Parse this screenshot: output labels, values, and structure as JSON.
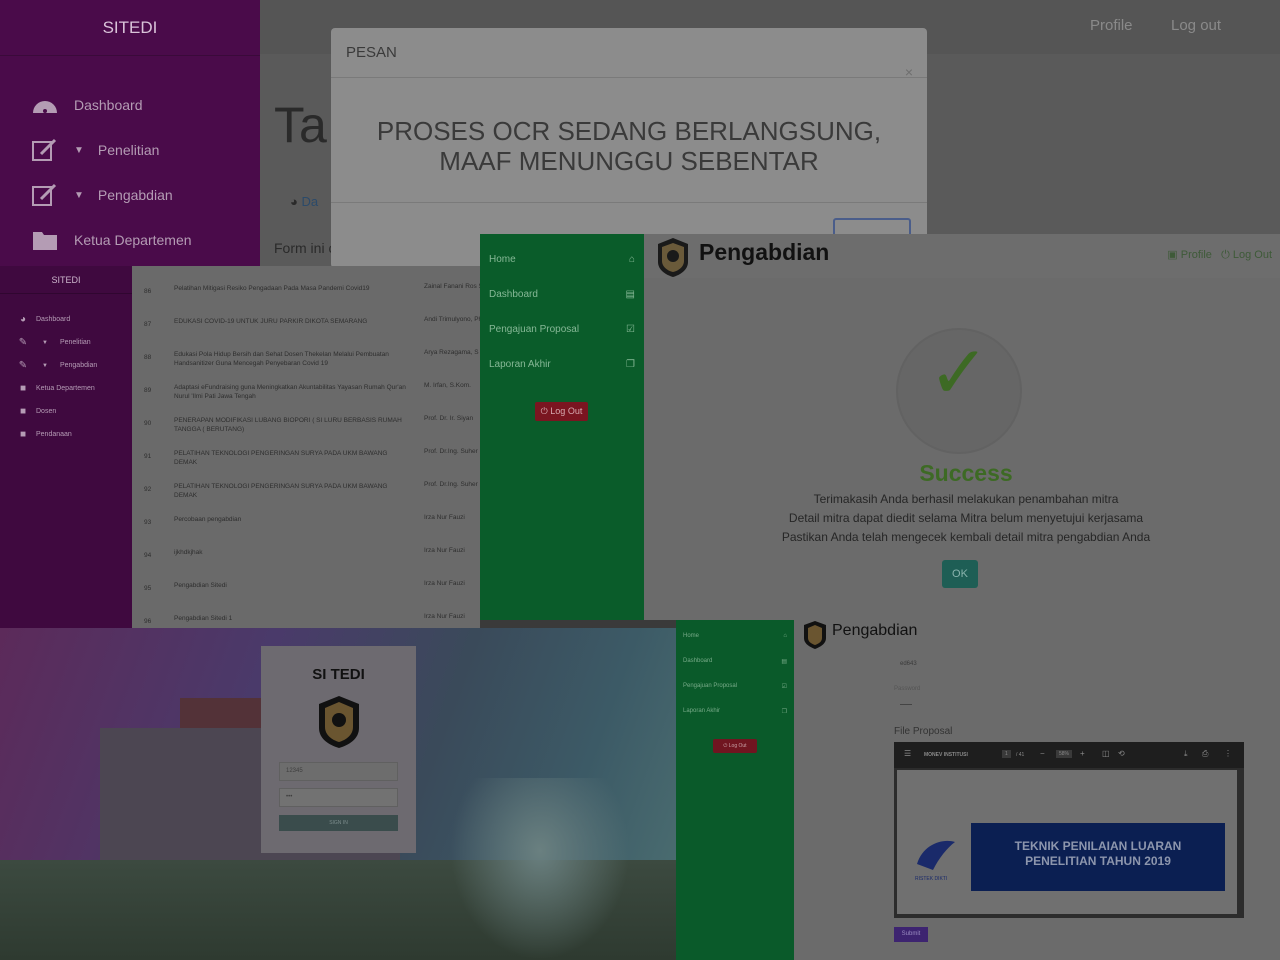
{
  "panel1": {
    "brand": "SITEDI",
    "nav": [
      "Dashboard",
      "Penelitian",
      "Pengabdian",
      "Ketua Departemen"
    ],
    "top_links": [
      "Profile",
      "Log out"
    ],
    "page_title": "Ta",
    "breadcrumb": "Da",
    "form_text": "Form ini c",
    "modal": {
      "title": "PESAN",
      "close": "×",
      "line1": "PROSES OCR SEDANG BERLANGSUNG,",
      "line2": "MAAF MENUNGGU SEBENTAR"
    }
  },
  "panel2": {
    "brand": "SITEDI",
    "nav": [
      "Dashboard",
      "Penelitian",
      "Pengabdian",
      "Ketua Departemen",
      "Dosen",
      "Pendanaan"
    ],
    "rows": [
      {
        "num": "86",
        "title": "Pelatihan Mitigasi Resiko Pengadaan Pada Masa Pandemi Covid19",
        "who": "Zainal Fanani Ros S.T., M.T."
      },
      {
        "num": "87",
        "title": "EDUKASI COVID-19 UNTUK JURU PARKIR DIKOTA SEMARANG",
        "who": "Andi Trimulyono, Ph.D."
      },
      {
        "num": "88",
        "title": "Edukasi Pola Hidup Bersih dan Sehat Dosen Thekelan Melalui Pembuatan Handsanitizer Guna Mencegah Penyebaran Covid 19",
        "who": "Arya Rezagama, S"
      },
      {
        "num": "89",
        "title": "Adaptasi eFundraising guna Meningkatkan Akuntabilitas Yayasan Rumah Qur'an Nurul 'Ilmi Pati Jawa Tengah",
        "who": "M. Irfan, S.Kom."
      },
      {
        "num": "90",
        "title": "PENERAPAN MODIFIKASI LUBANG BIOPORI ( SI LURU BERBASIS RUMAH TANGGA ( BERUTANG)",
        "who": "Prof. Dr. Ir. Siyan"
      },
      {
        "num": "91",
        "title": "PELATIHAN TEKNOLOGI PENGERINGAN SURYA PADA UKM BAWANG DEMAK",
        "who": "Prof. Dr.Ing. Suher S.T., M.T."
      },
      {
        "num": "92",
        "title": "PELATIHAN TEKNOLOGI PENGERINGAN SURYA PADA UKM BAWANG DEMAK",
        "who": "Prof. Dr.Ing. Suher S.T., M.T."
      },
      {
        "num": "93",
        "title": "Percobaan pengabdian",
        "who": "Irza Nur Fauzi"
      },
      {
        "num": "94",
        "title": "ijkhdkjhak",
        "who": "Irza Nur Fauzi"
      },
      {
        "num": "95",
        "title": "Pengabdian Sitedi",
        "who": "Irza Nur Fauzi"
      },
      {
        "num": "96",
        "title": "Pengabdian Sitedi 1",
        "who": "Irza Nur Fauzi"
      }
    ]
  },
  "panel3": {
    "nav": [
      "Home",
      "Dashboard",
      "Pengajuan Proposal",
      "Laporan Akhir"
    ],
    "logout_button": "Log Out",
    "title": "Pengabdian",
    "top_links": [
      "Profile",
      "Log Out"
    ],
    "success_title": "Success",
    "messages": [
      "Terimakasih Anda berhasil melakukan penambahan mitra",
      "Detail mitra dapat diedit selama Mitra belum menyetujui kerjasama",
      "Pastikan Anda telah mengecek kembali detail mitra pengabdian Anda"
    ],
    "ok_button": "OK"
  },
  "panel4": {
    "title": "SI TEDI",
    "username_value": "12345",
    "password_value": "•••",
    "sign_in": "SIGN IN"
  },
  "panel5": {
    "nav": [
      "Home",
      "Dashboard",
      "Pengajuan Proposal",
      "Laporan Akhir"
    ],
    "logout_button": "Log Out",
    "title": "Pengabdian",
    "field_value": "ed643",
    "password_label": "Password",
    "file_label": "File Proposal",
    "pdf": {
      "doc_title": "MONEV INSTITUSI",
      "page": "1",
      "pages": "/ 41",
      "zoom": "58%",
      "banner_line1": "TEKNIK PENILAIAN LUARAN",
      "banner_line2": "PENELITIAN TAHUN 2019",
      "org": "RISTEK DIKTI"
    },
    "submit": "Submit"
  }
}
